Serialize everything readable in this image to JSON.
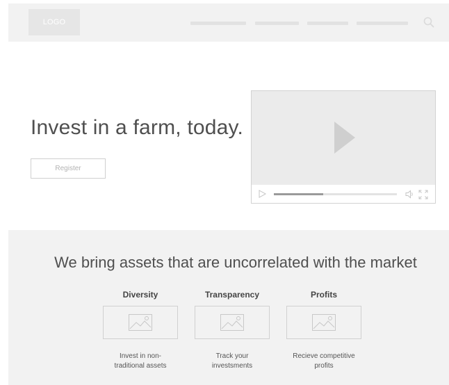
{
  "header": {
    "logo_text": "LOGO",
    "nav_links": [
      "",
      "",
      "",
      ""
    ],
    "search_icon": "search-icon"
  },
  "hero": {
    "title": "Invest in a farm, today.",
    "register_label": "Register"
  },
  "video": {
    "progress": 0.4,
    "icons": [
      "play-icon",
      "play-small-icon",
      "volume-icon",
      "fullscreen-icon"
    ]
  },
  "features": {
    "title": "We bring assets that are uncorrelated with the market",
    "items": [
      {
        "title": "Diversity",
        "description": "Invest in non-\ntraditional assets",
        "icon": "image-placeholder-icon"
      },
      {
        "title": "Transparency",
        "description": "Track your\ninvestsments",
        "icon": "image-placeholder-icon"
      },
      {
        "title": "Profits",
        "description": "Recieve competitive\nprofits",
        "icon": "image-placeholder-icon"
      }
    ]
  },
  "colors": {
    "panel_background": "#f2f2f2",
    "text_dark": "#4f4f4f",
    "border": "#d0d0d0"
  }
}
